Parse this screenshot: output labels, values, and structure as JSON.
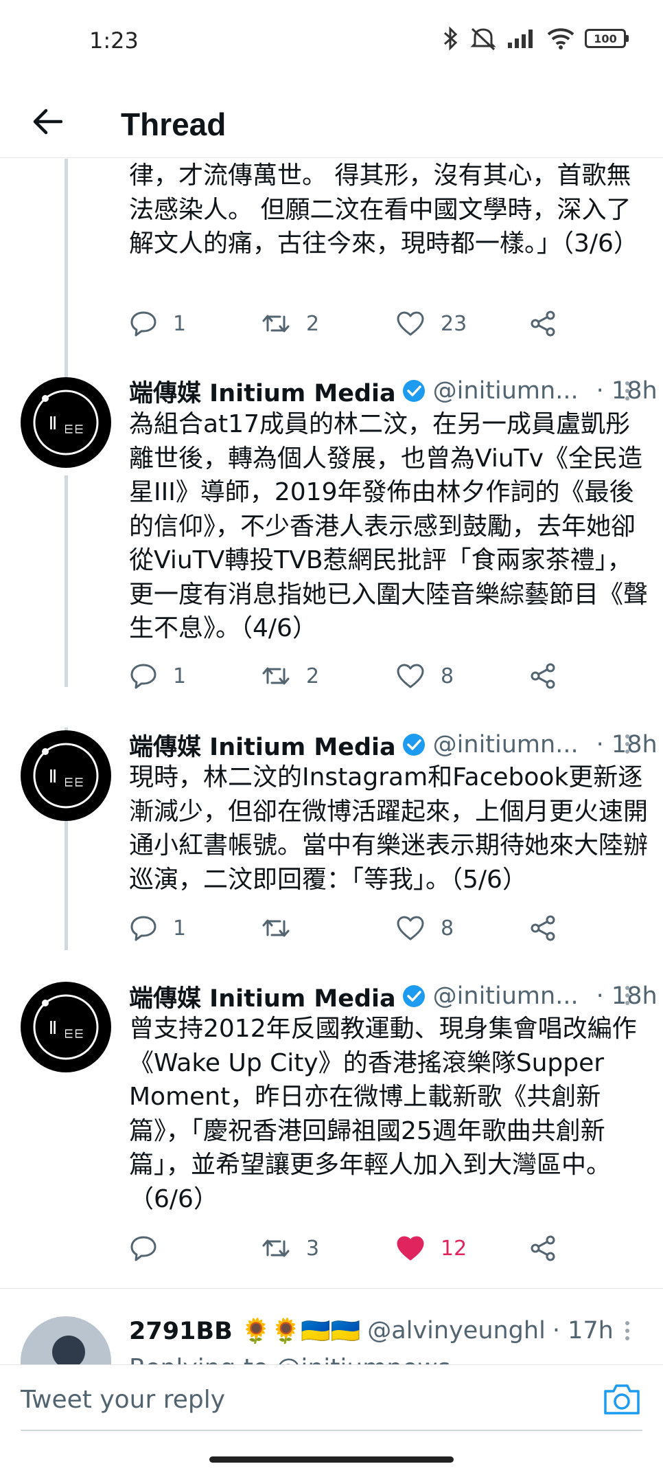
{
  "status_bar": {
    "time": "1:23",
    "battery": "100"
  },
  "header": {
    "title": "Thread"
  },
  "colors": {
    "accent": "#1d9bf0",
    "like": "#e0245e",
    "text": "#0f1419",
    "muted": "#536471",
    "thread_line": "#cfd9de"
  },
  "partial_tweet": {
    "text": "律，才流傳萬世。 得其形，沒有其心，首歌無法感染人。 但願二汶在看中國文學時，深入了解文人的痛，古往今來，現時都一樣。」（3/6）",
    "replies": "1",
    "retweets": "2",
    "likes": "23"
  },
  "tweets": [
    {
      "name": "端傳媒 Initium Media",
      "handle": "@initiumn...",
      "time": "· 18h",
      "text": "為組合at17成員的林二汶，在另一成員盧凱彤離世後，轉為個人發展，也曾為ViuTv《全民造星III》導師，2019年發佈由林夕作詞的《最後的信仰》，不少香港人表示感到鼓勵，去年她卻從ViuTV轉投TVB惹網民批評「食兩家茶禮」，更一度有消息指她已入圍大陸音樂綜藝節目《聲生不息》。（4/6）",
      "replies": "1",
      "retweets": "2",
      "likes": "8"
    },
    {
      "name": "端傳媒 Initium Media",
      "handle": "@initiumn...",
      "time": "· 18h",
      "text": "現時，林二汶的Instagram和Facebook更新逐漸減少，但卻在微博活躍起來，上個月更火速開通小紅書帳號。當中有樂迷表示期待她來大陸辦巡演，二汶即回覆：「等我」。（5/6）",
      "replies": "1",
      "retweets": "",
      "likes": "8"
    },
    {
      "name": "端傳媒 Initium Media",
      "handle": "@initiumn...",
      "time": "· 18h",
      "text": "曾支持2012年反國教運動、現身集會唱改編作《Wake Up City》的香港搖滾樂隊Supper Moment，昨日亦在微博上載新歌《共創新篇》，「慶祝香港回歸祖國25週年歌曲共創新篇」，並希望讓更多年輕人加入到大灣區中。（6/6）",
      "replies": "",
      "retweets": "3",
      "likes": "12"
    }
  ],
  "reply_tweet": {
    "name": "2791BB 🌻🌻🇺🇦🇺🇦",
    "handle": "@alvinyeunghl",
    "time": "· 17h",
    "replying": "Replying to @initiumnews"
  },
  "reply_bar": {
    "placeholder": "Tweet your reply"
  }
}
